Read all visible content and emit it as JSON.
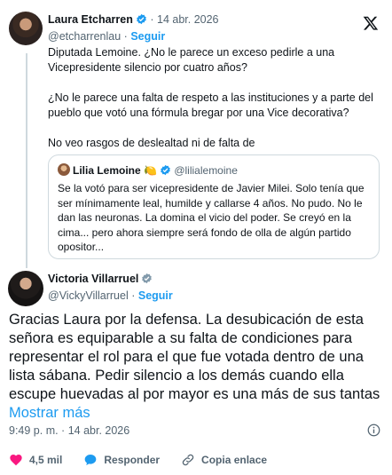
{
  "colors": {
    "accent": "#1d9bf0",
    "muted": "#536471",
    "like": "#f91880",
    "verified": "#1d9bf0"
  },
  "reply_tweet": {
    "author_name": "Laura Etcharren",
    "date": "· 14 abr. 2026",
    "handle": "@etcharrenlau",
    "separator": "·",
    "follow_label": "Seguir",
    "paragraphs": [
      "Diputada Lemoine. ¿No le parece un exceso pedirle a una Vicepresidente silencio por cuatro años?",
      "¿No le parece una falta de respeto a las instituciones y a parte del pueblo que votó una fórmula bregar por una Vice decorativa?",
      "No veo rasgos de deslealtad ni de falta de"
    ]
  },
  "quoted_tweet": {
    "author_name": "Lilia Lemoine",
    "emoji": "🍋",
    "handle": "@lilialemoine",
    "text": "Se la votó para ser vicepresidente de Javier Milei. Solo tenía que ser mínimamente leal, humilde y callarse 4 años. No pudo. No le dan las neuronas. La domina el vicio del poder. Se creyó en la cima... pero   ahora siempre será fondo de  olla de algún partido opositor..."
  },
  "main_tweet": {
    "author_name": "Victoria Villarruel",
    "handle": "@VickyVillarruel",
    "separator": "·",
    "follow_label": "Seguir",
    "text": "Gracias Laura por la defensa. La desubicación de esta señora es equiparable a su falta de condiciones para representar el rol para el que fue votada dentro de una lista sábana. Pedir silencio a los demás cuando ella escupe huevadas al por mayor es una más de sus tantas ",
    "show_more": "Mostrar más",
    "timestamp": "9:49 p. m. · 14 abr. 2026"
  },
  "actions": {
    "likes": "4,5 mil",
    "reply_label": "Responder",
    "copy_link_label": "Copia enlace"
  },
  "icons": [
    "x-logo-icon",
    "verified-badge-icon",
    "info-icon",
    "heart-icon",
    "reply-bubble-icon",
    "link-icon"
  ]
}
